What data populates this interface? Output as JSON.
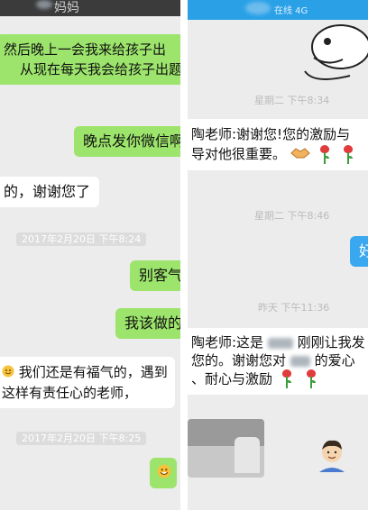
{
  "left": {
    "header_title": "妈妈",
    "messages": [
      {
        "line1": "然后晚上一会我来给孩子出",
        "line2": "从现在每天我会给孩子出题"
      },
      {
        "text": "晚点发你微信啊"
      },
      {
        "text": "的，谢谢您了"
      },
      {
        "text": "别客气"
      },
      {
        "text": "我该做的"
      },
      {
        "line1": "我们还是有福气的，遇到",
        "line2": "这样有责任心的老师，"
      }
    ],
    "timestamps": [
      "2017年2月20日 下午8:24",
      "2017年2月20日 下午8:25"
    ]
  },
  "right": {
    "status_text": "在线 4G",
    "timestamps": [
      "星期二 下午8:34",
      "星期二 下午8:46",
      "昨天 下午11:36"
    ],
    "messages": [
      {
        "line1": "陶老师:谢谢您!您的激励与",
        "line2": "导对他很重要。"
      },
      {
        "text": "好"
      },
      {
        "line1": "陶老师:这是",
        "line1b": "刚刚让我发",
        "line2": "您的。谢谢您对",
        "line2b": "的爱心",
        "line3": "、耐心与激励"
      }
    ]
  },
  "icons": {
    "handshake": "handshake-icon",
    "rose": "rose-icon",
    "smile": "smile-emoji-icon"
  },
  "colors": {
    "chat_bg": "#ececec",
    "green_bubble": "#9ce46b",
    "white_bubble": "#ffffff",
    "right_header": "#2aa1e6",
    "left_header": "#3b3b3b"
  }
}
